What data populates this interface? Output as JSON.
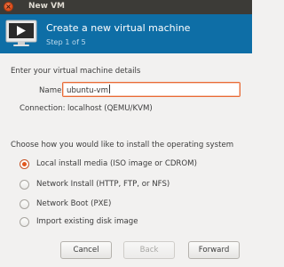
{
  "window": {
    "title": "New VM",
    "close_glyph": "×"
  },
  "header": {
    "title": "Create a new virtual machine",
    "step": "Step 1 of 5",
    "icon": "virtual-machine-monitor-icon",
    "background": "#0e6ea6"
  },
  "details": {
    "heading": "Enter your virtual machine details",
    "name_label": "Name:",
    "name_value": "ubuntu-vm",
    "connection_label": "Connection:",
    "connection_value": "localhost (QEMU/KVM)"
  },
  "install": {
    "heading": "Choose how you would like to install the operating system",
    "options": [
      {
        "label": "Local install media (ISO image or CDROM)",
        "selected": true
      },
      {
        "label": "Network Install (HTTP, FTP, or NFS)",
        "selected": false
      },
      {
        "label": "Network Boot (PXE)",
        "selected": false
      },
      {
        "label": "Import existing disk image",
        "selected": false
      }
    ]
  },
  "buttons": {
    "cancel": "Cancel",
    "back": "Back",
    "forward": "Forward"
  },
  "colors": {
    "accent": "#e96a35",
    "titlebar": "#3c3b37"
  }
}
